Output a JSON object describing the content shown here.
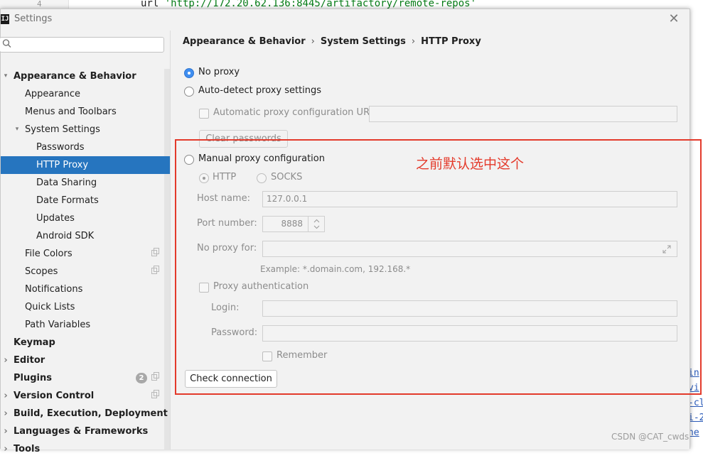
{
  "background": {
    "line_number": "4",
    "code_prefix": "url ",
    "code_string": "'http://172.20.62.136:8445/artifactory/remote-repos'",
    "right_fragments": [
      "in",
      "vi",
      "-cl",
      "i-2",
      "he"
    ]
  },
  "dialog": {
    "icon_text": "IJ",
    "title": "Settings"
  },
  "sidebar": {
    "search_placeholder": "",
    "items": [
      {
        "label": "Appearance & Behavior",
        "level": 0,
        "expanded": true,
        "bold": true
      },
      {
        "label": "Appearance",
        "level": 1
      },
      {
        "label": "Menus and Toolbars",
        "level": 1
      },
      {
        "label": "System Settings",
        "level": 1,
        "expanded": true
      },
      {
        "label": "Passwords",
        "level": 2
      },
      {
        "label": "HTTP Proxy",
        "level": 2,
        "selected": true
      },
      {
        "label": "Data Sharing",
        "level": 2
      },
      {
        "label": "Date Formats",
        "level": 2
      },
      {
        "label": "Updates",
        "level": 2
      },
      {
        "label": "Android SDK",
        "level": 2
      },
      {
        "label": "File Colors",
        "level": 1,
        "copy_icon": true
      },
      {
        "label": "Scopes",
        "level": 1,
        "copy_icon": true
      },
      {
        "label": "Notifications",
        "level": 1
      },
      {
        "label": "Quick Lists",
        "level": 1
      },
      {
        "label": "Path Variables",
        "level": 1
      },
      {
        "label": "Keymap",
        "level": 0,
        "bold": true
      },
      {
        "label": "Editor",
        "level": 0,
        "collapsed": true,
        "bold": true
      },
      {
        "label": "Plugins",
        "level": 0,
        "bold": true,
        "badge": "2",
        "copy_icon": true
      },
      {
        "label": "Version Control",
        "level": 0,
        "collapsed": true,
        "bold": true,
        "copy_icon": true
      },
      {
        "label": "Build, Execution, Deployment",
        "level": 0,
        "collapsed": true,
        "bold": true
      },
      {
        "label": "Languages & Frameworks",
        "level": 0,
        "collapsed": true,
        "bold": true
      },
      {
        "label": "Tools",
        "level": 0,
        "collapsed": true,
        "bold": true
      }
    ]
  },
  "breadcrumb": [
    "Appearance & Behavior",
    "System Settings",
    "HTTP Proxy"
  ],
  "breadcrumb_sep": "›",
  "proxy": {
    "no_proxy_label": "No proxy",
    "auto_detect_label": "Auto-detect proxy settings",
    "auto_config_url_label": "Automatic proxy configuration URL:",
    "auto_config_url_value": "",
    "clear_passwords_label": "Clear passwords",
    "manual_label": "Manual proxy configuration",
    "http_label": "HTTP",
    "socks_label": "SOCKS",
    "host_label": "Host name:",
    "host_value": "127.0.0.1",
    "port_label": "Port number:",
    "port_value": "8888",
    "no_proxy_for_label": "No proxy for:",
    "no_proxy_for_value": "",
    "example_text": "Example: *.domain.com, 192.168.*",
    "proxy_auth_label": "Proxy authentication",
    "login_label": "Login:",
    "login_value": "",
    "password_label": "Password:",
    "password_value": "",
    "remember_label": "Remember",
    "check_connection_label": "Check connection",
    "selected_mode": "no_proxy"
  },
  "annotation": {
    "text": "之前默认选中这个",
    "color": "#e43a2b"
  },
  "watermark": "CSDN @CAT_cwds",
  "colors": {
    "selection": "#2675bf",
    "radio_checked": "#3f8ef0",
    "annotation_border": "#e33a2b",
    "dialog_bg": "#f2f2f2"
  },
  "icons": {
    "close": "close-icon",
    "search": "search-icon",
    "expand": "expand-icon",
    "spinner": "spinner-icon"
  }
}
